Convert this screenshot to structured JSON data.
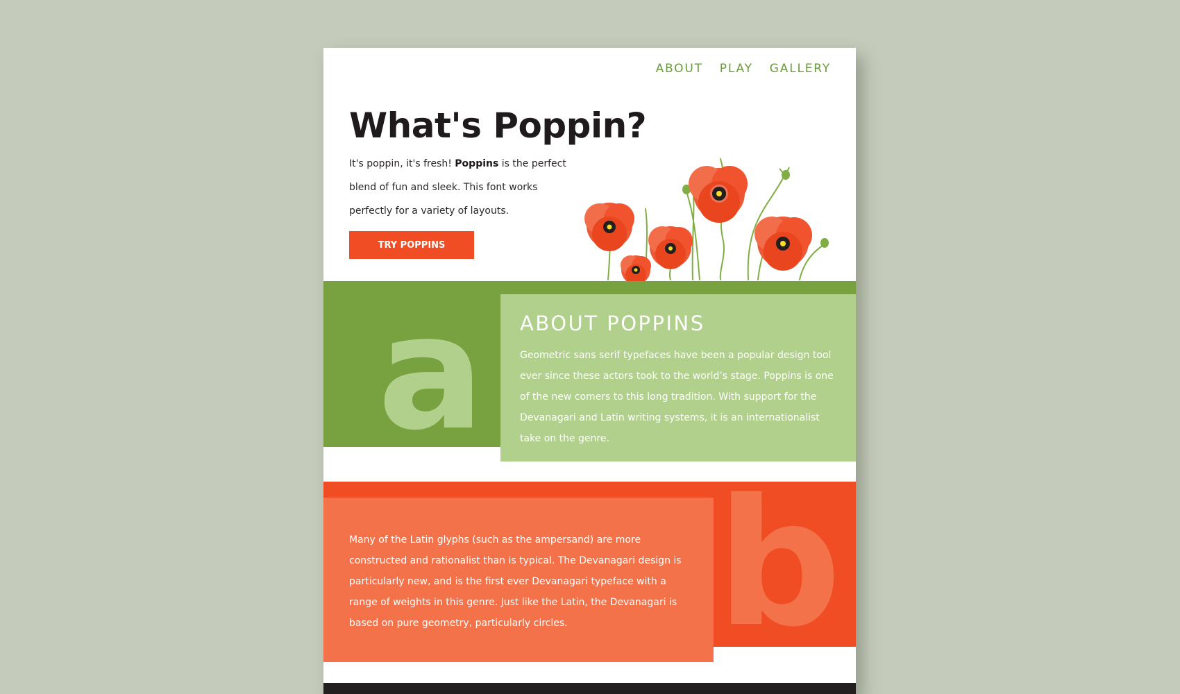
{
  "nav": {
    "items": [
      "ABOUT",
      "PLAY",
      "GALLERY"
    ]
  },
  "hero": {
    "title": "What's Poppin?",
    "text_before": "It's poppin, it's fresh! ",
    "text_bold": "Poppins",
    "text_after": " is the perfect blend of fun and sleek. This font works perfectly for a variety of layouts.",
    "button": "TRY POPPINS"
  },
  "about": {
    "letter": "a",
    "title": "ABOUT POPPINS",
    "text": "Geometric sans serif typefaces have been a popular design tool ever since these actors took to the world’s stage. Poppins is one of the new comers to this long tradition. With support for the Devanagari and Latin writing systems, it is an internationalist take on the genre."
  },
  "section_b": {
    "letter": "b",
    "text": "Many of the Latin glyphs (such as the ampersand) are more constructed and rationalist than is typical. The Devanagari design is particularly new, and is the first ever Devanagari typeface with a range of weights in this genre. Just like the Latin, the Devanagari is based on pure geometry, particularly circles."
  },
  "colors": {
    "background": "#c4cbba",
    "green_dark": "#78a13f",
    "green_light": "#b0d08b",
    "orange": "#f14d24",
    "orange_light": "#f3724a",
    "nav_green": "#6a9a3b",
    "dark": "#231f20"
  },
  "icons": {
    "hero_image": "poppy-flowers-illustration"
  }
}
